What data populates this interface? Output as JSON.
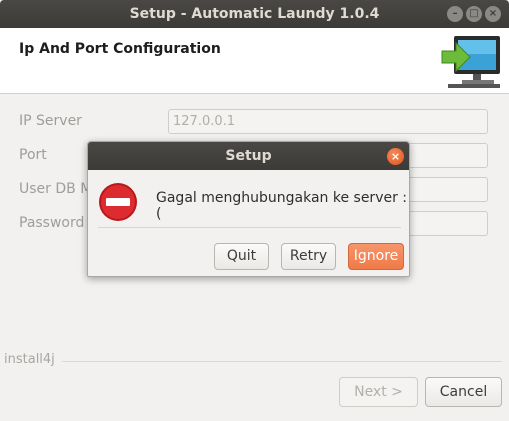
{
  "window": {
    "title": "Setup - Automatic Laundy 1.0.4",
    "controls": [
      "–",
      "□",
      "×"
    ]
  },
  "header": {
    "title": "Ip And Port Configuration",
    "icon": "monitor-arrow-icon"
  },
  "form": {
    "fields": [
      {
        "label": "IP Server",
        "value": "127.0.0.1"
      },
      {
        "label": "Port",
        "value": ""
      },
      {
        "label": "User DB M",
        "value": ""
      },
      {
        "label": "Password",
        "value": ""
      }
    ]
  },
  "footer": {
    "brand": "install4j",
    "next_label": "Next >",
    "cancel_label": "Cancel"
  },
  "dialog": {
    "title": "Setup",
    "close_label": "×",
    "message": "Gagal menghubungakan ke server :(",
    "icon": "stop-icon",
    "buttons": {
      "quit": "Quit",
      "retry": "Retry",
      "ignore": "Ignore"
    }
  },
  "colors": {
    "accent": "#ef7a48",
    "titlebar": "#3c3b37",
    "stop": "#d8262a"
  }
}
